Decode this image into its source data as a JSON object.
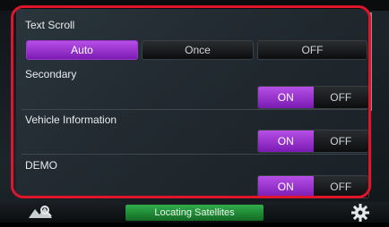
{
  "text_scroll": {
    "label": "Text Scroll",
    "options": [
      "Auto",
      "Once",
      "OFF"
    ],
    "selected": "Auto"
  },
  "settings": [
    {
      "label": "Secondary",
      "on_label": "ON",
      "off_label": "OFF",
      "selected": "ON"
    },
    {
      "label": "Vehicle Information",
      "on_label": "ON",
      "off_label": "OFF",
      "selected": "ON"
    },
    {
      "label": "DEMO",
      "on_label": "ON",
      "off_label": "OFF",
      "selected": "ON"
    }
  ],
  "status_bar": {
    "text": "Locating Satellites",
    "left_icon": "map-search-icon",
    "right_icon": "gear-icon"
  },
  "colors": {
    "selected_accent": "#a33fd8",
    "status_green": "#2fae4a",
    "highlight_frame": "#e0142a"
  }
}
